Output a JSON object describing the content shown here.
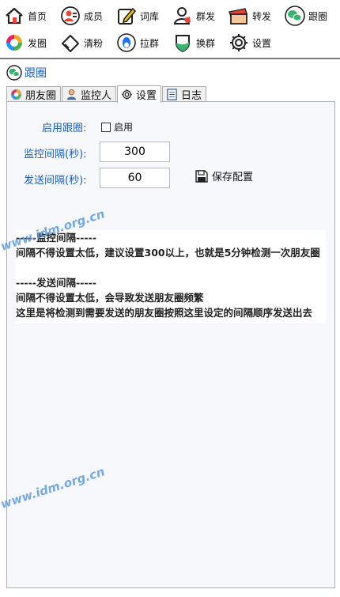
{
  "toolbar": {
    "items": [
      {
        "label": "首页",
        "icon": "home-icon"
      },
      {
        "label": "成员",
        "icon": "member-icon"
      },
      {
        "label": "词库",
        "icon": "edit-icon"
      },
      {
        "label": "群发",
        "icon": "users-icon"
      },
      {
        "label": "转发",
        "icon": "forward-icon"
      },
      {
        "label": "跟圈",
        "icon": "wechat-icon"
      },
      {
        "label": "发圈",
        "icon": "moments-icon"
      },
      {
        "label": "清粉",
        "icon": "eraser-icon"
      },
      {
        "label": "拉群",
        "icon": "penguin-icon"
      },
      {
        "label": "换群",
        "icon": "shield-icon"
      },
      {
        "label": "设置",
        "icon": "gear-icon"
      }
    ]
  },
  "section": {
    "title": "跟圈"
  },
  "tabs": [
    {
      "label": "朋友圈",
      "icon": "moments-icon"
    },
    {
      "label": "监控人",
      "icon": "person-icon"
    },
    {
      "label": "设置",
      "icon": "gear-icon",
      "active": true
    },
    {
      "label": "日志",
      "icon": "log-icon"
    }
  ],
  "settings": {
    "enable_label": "启用跟圈:",
    "enable_checkbox_label": "启用",
    "enable_checked": false,
    "monitor_label": "监控间隔(秒):",
    "monitor_value": "300",
    "send_label": "发送间隔(秒):",
    "send_value": "60",
    "save_label": "保存配置"
  },
  "note": {
    "lines": [
      "-----监控间隔-----",
      "间隔不得设置太低，建议设置300以上，也就是5分钟检测一次朋友圈",
      "",
      "-----发送间隔-----",
      "间隔不得设置太低，会导致发送朋友圈频繁",
      "这里是将检测到需要发送的朋友圈按照这里设定的间隔顺序发送出去"
    ]
  },
  "watermark": {
    "text": "www.idm.org.cn"
  },
  "colors": {
    "accent": "#1c5eb8",
    "panel_bg": "#f7f8fb",
    "watermark": "#4a8fd6"
  }
}
